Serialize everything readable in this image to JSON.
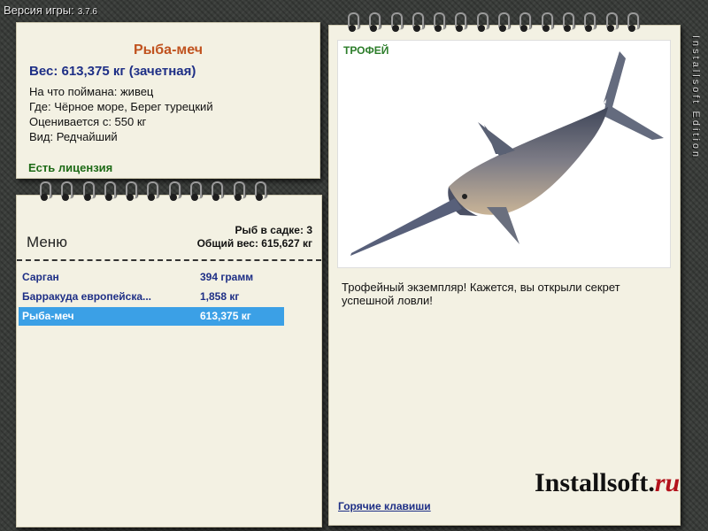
{
  "header": {
    "version_label": "Версия игры:",
    "version_number": "3.7.6"
  },
  "side_text": "Installsoft Edition",
  "fish_info": {
    "name": "Рыба-меч",
    "weight": "Вес: 613,375 кг (зачетная)",
    "caught_with": "На что поймана: живец",
    "location": "Где: Чёрное море, Берег турецкий",
    "rated_from": "Оценивается с: 550 кг",
    "kind": "Вид: Редчайший",
    "license": "Есть лицензия"
  },
  "menu": {
    "title": "Меню",
    "fish_count": "Рыб в садке: 3",
    "total_weight": "Общий вес: 615,627 кг",
    "items": [
      {
        "name": "Сарган",
        "weight": "394 грамм",
        "selected": false
      },
      {
        "name": "Барракуда европейска...",
        "weight": "1,858 кг",
        "selected": false
      },
      {
        "name": "Рыба-меч",
        "weight": "613,375 кг",
        "selected": true
      }
    ]
  },
  "trophy": {
    "label": "ТРОФЕЙ",
    "description": "Трофейный экземпляр! Кажется, вы открыли секрет успешной ловли!",
    "hotkeys": "Горячие клавиши"
  },
  "logo": {
    "main": "Installsoft.",
    "accent": "ru"
  },
  "colors": {
    "accent_blue": "#1e2f86",
    "name_orange": "#c0521e",
    "selected_bg": "#3ba0e6",
    "license_green": "#1d6a16"
  }
}
